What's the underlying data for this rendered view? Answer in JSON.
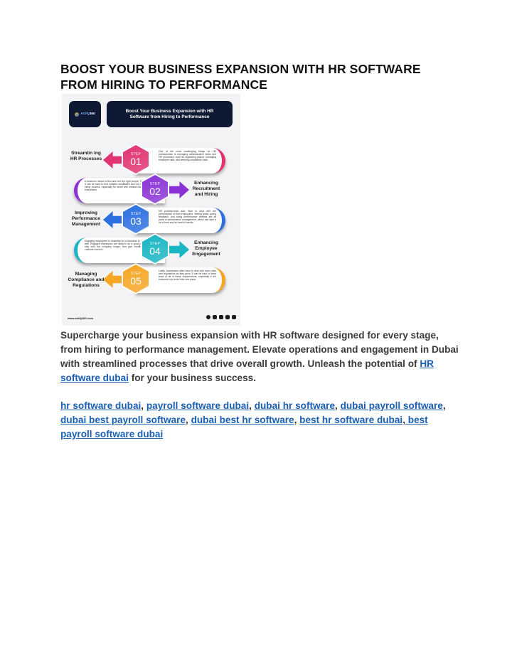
{
  "document": {
    "title_line1": "BOOST YOUR BUSINESS EXPANSION WITH HR SOFTWARE",
    "title_line2": "FROM HIRING TO PERFORMANCE"
  },
  "infographic": {
    "logo": {
      "brand": "Artify",
      "suffix": "360"
    },
    "banner": "Boost Your Business Expansion with HR Software from Hiring to Performance",
    "steps": [
      {
        "step_label": "STEP",
        "number": "01",
        "title": "Streamlin ing HR Processes",
        "side": "left",
        "color": "#e0336f",
        "text": "One of the most challenging things for HR professionals is managing administrative tasks and HR processes, such as organizing payroll, managing employee data, and keeping compliance track."
      },
      {
        "step_label": "STEP",
        "number": "02",
        "title": "Enhancing Recruitment and Hiring",
        "side": "right",
        "color": "#8a32d6",
        "text": "A business needs to find and hire the right people. But it can be hard to find suitable candidates and run the hiring process, especially for small and medium-sized businesses."
      },
      {
        "step_label": "STEP",
        "number": "03",
        "title": "Improving Performance Management",
        "side": "left",
        "color": "#2b6fe0",
        "text": "HR professionals also have to deal with the performance of their employees. Setting goals, giving feedback, and doing performance reviews are all parts of performance management, which can take a lot of time and be hard to handle."
      },
      {
        "step_label": "STEP",
        "number": "04",
        "title": "Enhancing Employee Engagement",
        "side": "right",
        "color": "#18b5c4",
        "text": "Engaging employees is essential for a business to do well. Engaged employees are likely to do a good job, stay with the company longer, and give excellent customer service."
      },
      {
        "step_label": "STEP",
        "number": "05",
        "title": "Managing Compliance and Regulations",
        "side": "left",
        "color": "#f5a623",
        "text": "Lastly, businesses often have to deal with more rules and regulations as they grow. It can be hard to keep track of all of these requirements, especially if the business is in more than one place."
      }
    ],
    "footer_url": "www.artify360.com",
    "social_icons": [
      "facebook-icon",
      "instagram-icon",
      "twitter-icon",
      "linkedin-icon",
      "youtube-icon"
    ]
  },
  "body": {
    "paragraph_text": "Supercharge your business expansion with HR software designed for every stage, from hiring to performance management. Elevate operations and engagement in Dubai with streamlined processes that drive overall growth. Unleash the potential of ",
    "paragraph_link": "HR software dubai",
    "paragraph_end": " for your business success.",
    "separator": ", ",
    "keyword_links": [
      "hr software dubai",
      "payroll software dubai",
      "dubai hr software",
      "dubai payroll software",
      "dubai best payroll software",
      "dubai best hr software",
      "best hr software dubai",
      " best payroll software dubai"
    ]
  }
}
